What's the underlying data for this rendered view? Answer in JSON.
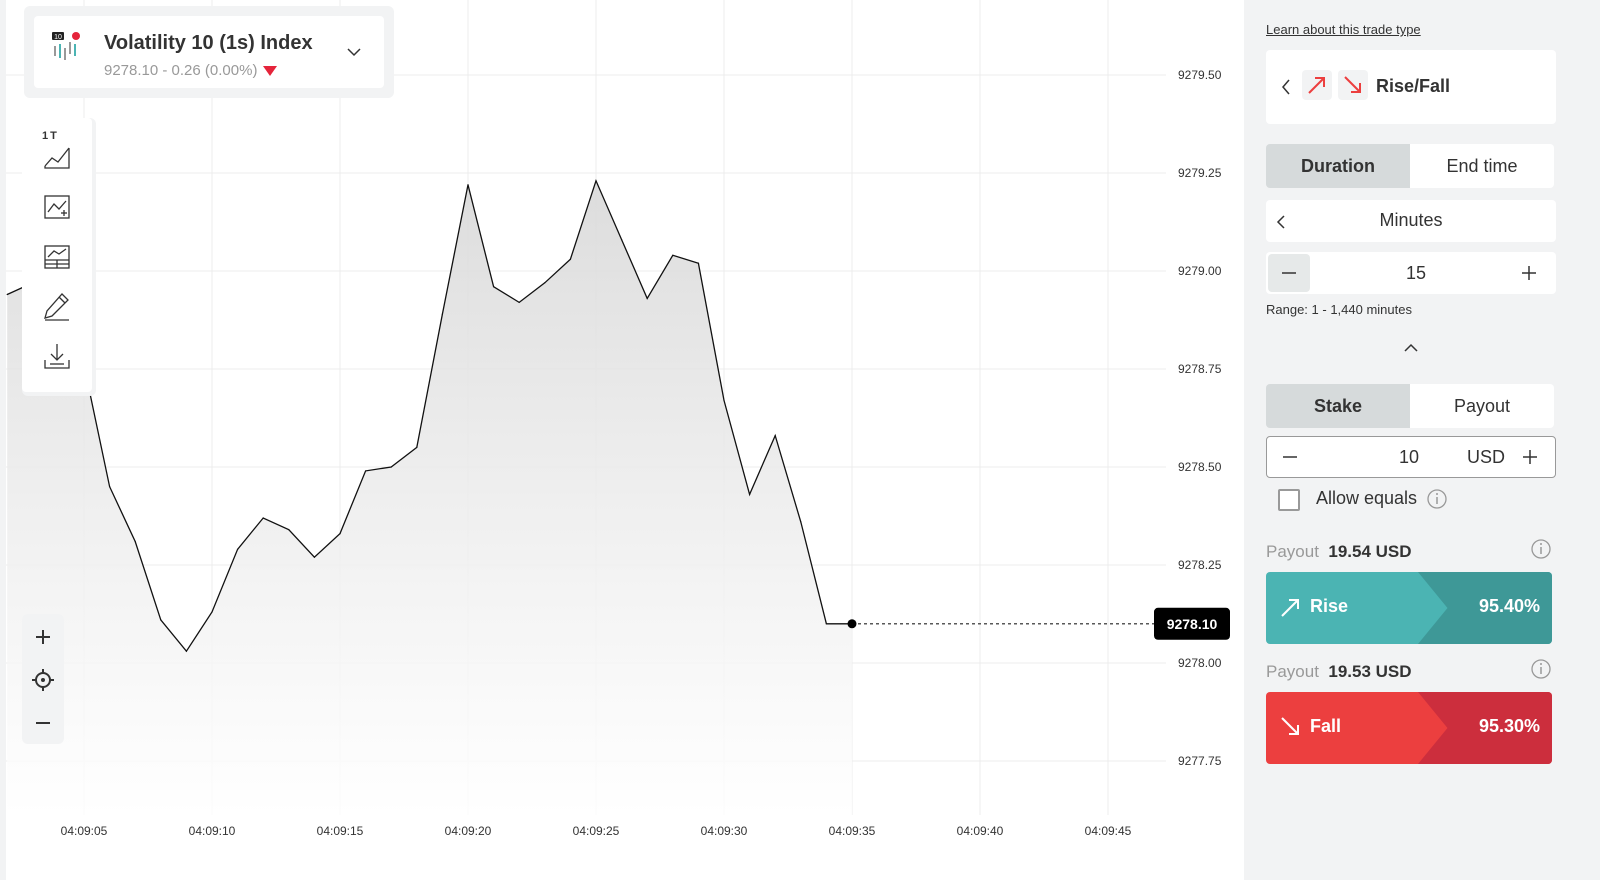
{
  "symbol": {
    "name": "Volatility 10 (1s) Index",
    "subtitle": "9278.10 - 0.26 (0.00%)",
    "icon_badge": "10"
  },
  "toolbar": {
    "tick_label": "1T",
    "tools": [
      "area-chart-icon",
      "indicators-icon",
      "templates-icon",
      "drawing-pencil-icon",
      "download-icon"
    ]
  },
  "chart_data": {
    "type": "area",
    "x": [
      "04:09:02",
      "04:09:03",
      "04:09:04",
      "04:09:05",
      "04:09:06",
      "04:09:07",
      "04:09:08",
      "04:09:09",
      "04:09:10",
      "04:09:11",
      "04:09:12",
      "04:09:13",
      "04:09:14",
      "04:09:15",
      "04:09:16",
      "04:09:17",
      "04:09:18",
      "04:09:19",
      "04:09:20",
      "04:09:21",
      "04:09:22",
      "04:09:23",
      "04:09:24",
      "04:09:25",
      "04:09:26",
      "04:09:27",
      "04:09:28",
      "04:09:29",
      "04:09:30",
      "04:09:31",
      "04:09:32",
      "04:09:33",
      "04:09:34",
      "04:09:35"
    ],
    "values": [
      9278.94,
      9278.97,
      9279.07,
      9278.76,
      9278.45,
      9278.31,
      9278.11,
      9278.03,
      9278.13,
      9278.29,
      9278.37,
      9278.34,
      9278.27,
      9278.33,
      9278.49,
      9278.5,
      9278.55,
      9278.89,
      9279.22,
      9278.96,
      9278.92,
      9278.97,
      9279.03,
      9279.23,
      9279.08,
      9278.93,
      9279.04,
      9279.02,
      9278.67,
      9278.43,
      9278.58,
      9278.36,
      9278.1,
      9278.1
    ],
    "xticks": [
      "04:09:05",
      "04:09:10",
      "04:09:15",
      "04:09:20",
      "04:09:25",
      "04:09:30",
      "04:09:35",
      "04:09:40",
      "04:09:45"
    ],
    "yticks": [
      "9279.50",
      "9279.25",
      "9279.00",
      "9278.75",
      "9278.50",
      "9278.25",
      "9278.00",
      "9277.75"
    ],
    "ylim": [
      9277.75,
      9279.5
    ],
    "current_price": "9278.10",
    "grid": true
  },
  "trade_type": {
    "learn_link": "Learn about this trade type",
    "label": "Rise/Fall"
  },
  "duration": {
    "tabs": [
      "Duration",
      "End time"
    ],
    "unit": "Minutes",
    "value": "15",
    "range": "Range: 1 - 1,440 minutes"
  },
  "stake": {
    "tabs": [
      "Stake",
      "Payout"
    ],
    "value": "10",
    "currency": "USD",
    "allow_equals": "Allow equals"
  },
  "rise": {
    "payout_label": "Payout",
    "payout_value": "19.54 USD",
    "label": "Rise",
    "percent": "95.40%",
    "color_main": "#4bb4b3",
    "color_dark": "#3e9897"
  },
  "fall": {
    "payout_label": "Payout",
    "payout_value": "19.53 USD",
    "label": "Fall",
    "percent": "95.30%",
    "color_main": "#ec3f3f",
    "color_dark": "#cc2e3d"
  }
}
